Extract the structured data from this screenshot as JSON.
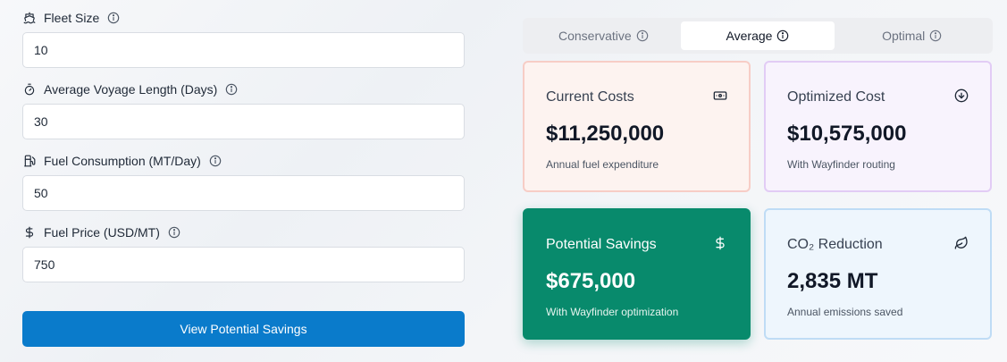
{
  "form": {
    "fields": [
      {
        "label": "Fleet Size",
        "value": "10",
        "icon": "ship-icon"
      },
      {
        "label": "Average Voyage Length (Days)",
        "value": "30",
        "icon": "timer-icon"
      },
      {
        "label": "Fuel Consumption (MT/Day)",
        "value": "50",
        "icon": "fuel-icon"
      },
      {
        "label": "Fuel Price (USD/MT)",
        "value": "750",
        "icon": "dollar-icon"
      }
    ],
    "submit_label": "View Potential Savings"
  },
  "tabs": [
    {
      "label": "Conservative",
      "active": false
    },
    {
      "label": "Average",
      "active": true
    },
    {
      "label": "Optimal",
      "active": false
    }
  ],
  "cards": {
    "current": {
      "title": "Current Costs",
      "value": "$11,250,000",
      "sub": "Annual fuel expenditure",
      "icon": "banknote-icon"
    },
    "optimized": {
      "title": "Optimized Cost",
      "value": "$10,575,000",
      "sub": "With Wayfinder routing",
      "icon": "arrow-down-circle-icon"
    },
    "savings": {
      "title": "Potential Savings",
      "value": "$675,000",
      "sub": "With Wayfinder optimization",
      "icon": "dollar-icon"
    },
    "co2": {
      "title": "CO₂ Reduction",
      "value": "2,835 MT",
      "sub": "Annual emissions saved",
      "icon": "leaf-icon"
    }
  },
  "colors": {
    "accent_blue": "#0a7bcb",
    "savings_green": "#088a6c",
    "current_bg": "#fdf3f0",
    "optimized_bg": "#f8f3fd",
    "co2_bg": "#eef6fd"
  }
}
